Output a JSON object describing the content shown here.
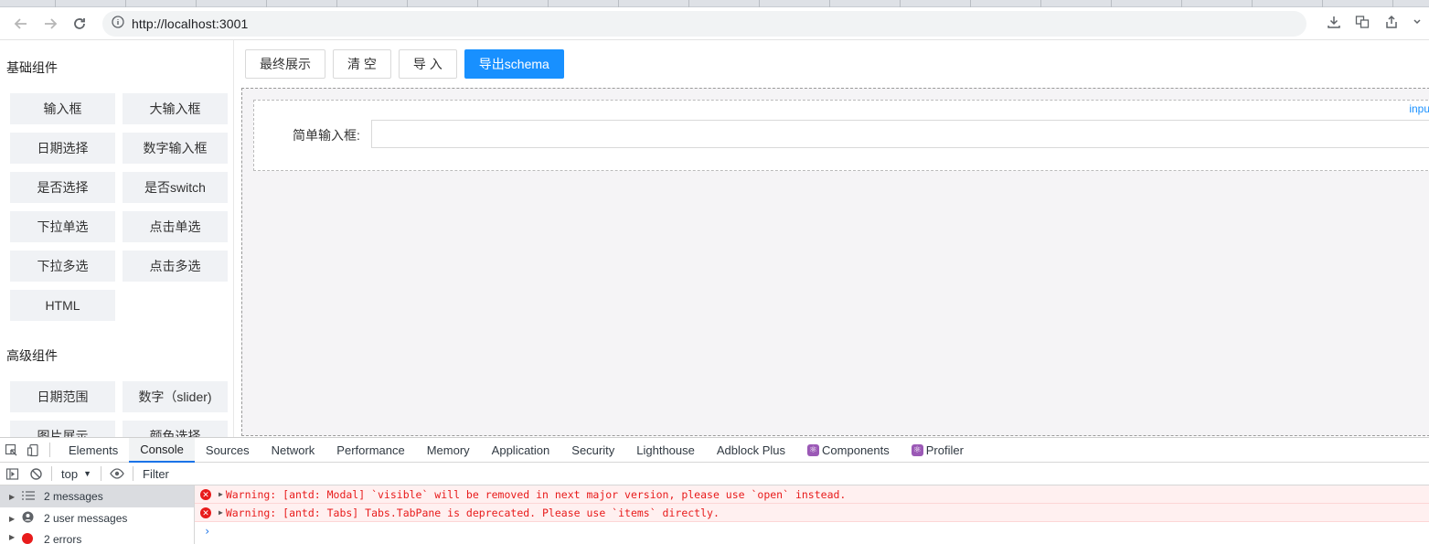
{
  "browser": {
    "url": "http://localhost:3001"
  },
  "sidebar": {
    "basic_title": "基础组件",
    "basic_items": [
      "输入框",
      "大输入框",
      "日期选择",
      "数字输入框",
      "是否选择",
      "是否switch",
      "下拉单选",
      "点击单选",
      "下拉多选",
      "点击多选",
      "HTML"
    ],
    "advanced_title": "高级组件",
    "advanced_items": [
      "日期范围",
      "数字（slider)",
      "图片展示",
      "颜色选择"
    ]
  },
  "toolbar": {
    "final_label": "最终展示",
    "clear_label": "清 空",
    "import_label": "导 入",
    "export_label": "导出schema"
  },
  "canvas": {
    "field_label": "简单输入框:",
    "field_tag": "inputN"
  },
  "devtools": {
    "tabs": [
      "Elements",
      "Console",
      "Sources",
      "Network",
      "Performance",
      "Memory",
      "Application",
      "Security",
      "Lighthouse",
      "Adblock Plus",
      "Components",
      "Profiler"
    ],
    "active_tab": "Console",
    "context": "top",
    "filter_placeholder": "Filter",
    "side": {
      "messages": "2 messages",
      "user_messages": "2 user messages",
      "errors": "2 errors"
    },
    "logs": [
      "Warning: [antd: Modal] `visible` will be removed in next major version, please use `open` instead.",
      "Warning: [antd: Tabs] Tabs.TabPane is deprecated. Please use `items` directly."
    ],
    "prompt_symbol": "›"
  },
  "colors": {
    "primary": "#1890ff",
    "error": "#e81b1b",
    "canvas_bg": "#f5f4f6"
  }
}
